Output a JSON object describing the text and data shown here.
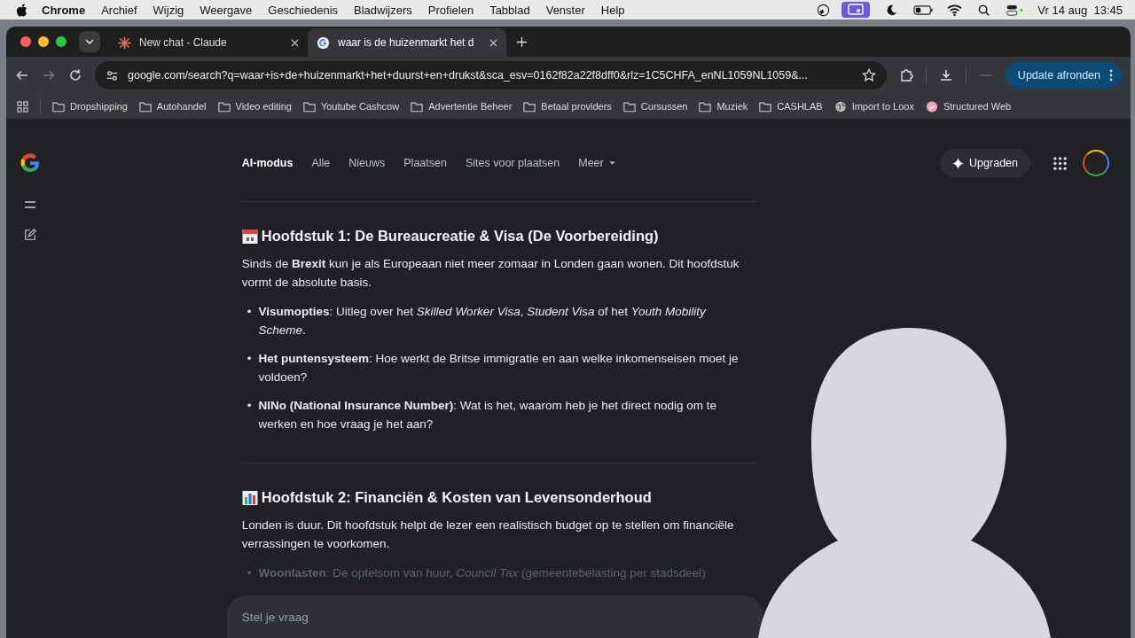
{
  "menubar": {
    "app": "Chrome",
    "menus": [
      "Archief",
      "Wijzig",
      "Weergave",
      "Geschiedenis",
      "Bladwijzers",
      "Profielen",
      "Tabblad",
      "Venster",
      "Help"
    ],
    "clock": "Vr 14 aug  13:45"
  },
  "tabs": [
    {
      "title": "New chat - Claude",
      "selected": false,
      "kind": "claude"
    },
    {
      "title": "waar is de huizenmarkt het d",
      "selected": true,
      "kind": "google"
    }
  ],
  "address": {
    "url": "google.com/search?q=waar+is+de+huizenmarkt+het+duurst+en+drukst&sca_esv=0162f82a22f8dff0&rlz=1C5CHFA_enNL1059NL1059&..."
  },
  "update_button": "Update afronden",
  "bookmarks": [
    {
      "label": "Dropshipping",
      "kind": "folder"
    },
    {
      "label": "Autohandel",
      "kind": "folder"
    },
    {
      "label": "Video editing",
      "kind": "folder"
    },
    {
      "label": "Youtube Cashcow",
      "kind": "folder"
    },
    {
      "label": "Advertentie Beheer",
      "kind": "folder"
    },
    {
      "label": "Betaal providers",
      "kind": "folder"
    },
    {
      "label": "Cursussen",
      "kind": "folder"
    },
    {
      "label": "Muziek",
      "kind": "folder"
    },
    {
      "label": "CASHLAB",
      "kind": "folder"
    },
    {
      "label": "Import to Loox",
      "kind": "globe"
    },
    {
      "label": "Structured Web",
      "kind": "badge"
    }
  ],
  "search_tabs": [
    {
      "label": "AI-modus",
      "selected": true
    },
    {
      "label": "Alle",
      "selected": false
    },
    {
      "label": "Nieuws",
      "selected": false
    },
    {
      "label": "Plaatsen",
      "selected": false
    },
    {
      "label": "Sites voor plaatsen",
      "selected": false
    },
    {
      "label": "Meer",
      "selected": false
    }
  ],
  "upgrade_button": "Upgraden",
  "sections": [
    {
      "kind": "calendar",
      "heading": "Hoofdstuk 1: De Bureaucreatie & Visa (De Voorbereiding)",
      "intro": "Sinds de **Brexit** kun je als Europeaan niet meer zomaar in Londen gaan wonen. Dit hoofdstuk vormt de absolute basis.",
      "bullets": [
        {
          "marker": "•",
          "text": "**Visumopties**: Uitleg over het *Skilled Worker Visa*, *Student Visa* of het *Youth Mobility Scheme*.",
          "faded": false
        },
        {
          "marker": "•",
          "text": "**Het puntensysteem**: Hoe werkt de Britse immigratie en aan welke inkomenseisen moet je voldoen?",
          "faded": false
        },
        {
          "marker": "•",
          "text": "**NINo (National Insurance Number)**: Wat is het, waarom heb je het direct nodig om te werken en hoe vraag je het aan?",
          "faded": false
        }
      ]
    },
    {
      "kind": "chart",
      "heading": "Hoofdstuk 2: Financiën & Kosten van Levensonderhoud",
      "intro": "Londen is duur. Dit hoofdstuk helpt de lezer een realistisch budget op te stellen om financiële verrassingen te voorkomen.",
      "bullets": [
        {
          "marker": "•",
          "text": "**Woonlasten**: De optelsom van huur, *Council Tax* (gemeentebelasting per stadsdeel)",
          "faded": true
        }
      ]
    }
  ],
  "prompt": {
    "placeholder": "Stel je vraag"
  }
}
